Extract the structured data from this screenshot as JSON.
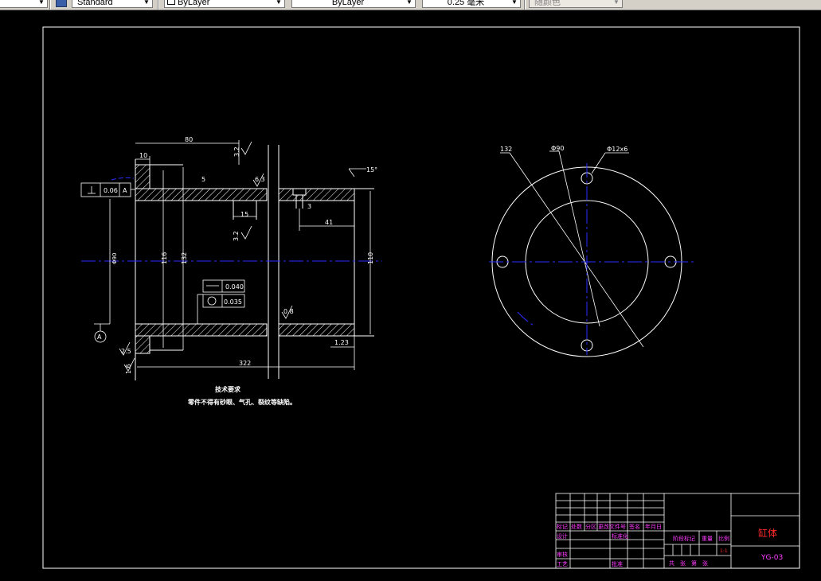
{
  "toolbar": {
    "text_style": "Standard",
    "layer_color": "ByLayer",
    "linetype": "ByLayer",
    "lineweight": "0.25 毫米",
    "plot_style": "随颜色"
  },
  "drawing": {
    "dims": {
      "len_80": "80",
      "len_10": "10",
      "ra_32_top": "3.2",
      "ra_32_mid": "3.2",
      "ra_63": "6.3",
      "wall_5": "5",
      "chamfer_15": "15°",
      "dim_15": "15",
      "dim_3": "3",
      "dim_41": "41",
      "dia_116": "116",
      "dia_132": "132",
      "dia_110": "110",
      "dia_90_tol": "Φ90",
      "ra_08": "0.8",
      "ra_25": "2.5",
      "ra_16": "1.6",
      "dim_123": "1.23",
      "len_322": "322",
      "datum": "A"
    },
    "tolerances": {
      "perp_value": "0.06",
      "perp_datum": "A",
      "straight_value": "0.040",
      "round_value": "0.035"
    },
    "notes": {
      "title": "技术要求",
      "line1": "零件不得有砂眼、气孔、裂纹等缺陷。"
    },
    "flange": {
      "pcd": "132",
      "bore": "Φ90",
      "holes": "Φ12x6"
    },
    "title_block": {
      "part_name": "缸体",
      "drawing_no": "YG-03",
      "h_mark": "标记",
      "h_count": "处数",
      "h_zone": "分区",
      "h_doc": "更改文件号",
      "h_sign": "签名",
      "h_date": "年月日",
      "h_design": "设计",
      "h_std": "标准化",
      "h_review": "审核",
      "h_process": "工艺",
      "h_approve": "批准",
      "h_stage": "阶段标记",
      "h_weight": "重量",
      "h_scale": "比例",
      "scale_val": "1:1",
      "sheets": "共　张　第　张"
    }
  }
}
